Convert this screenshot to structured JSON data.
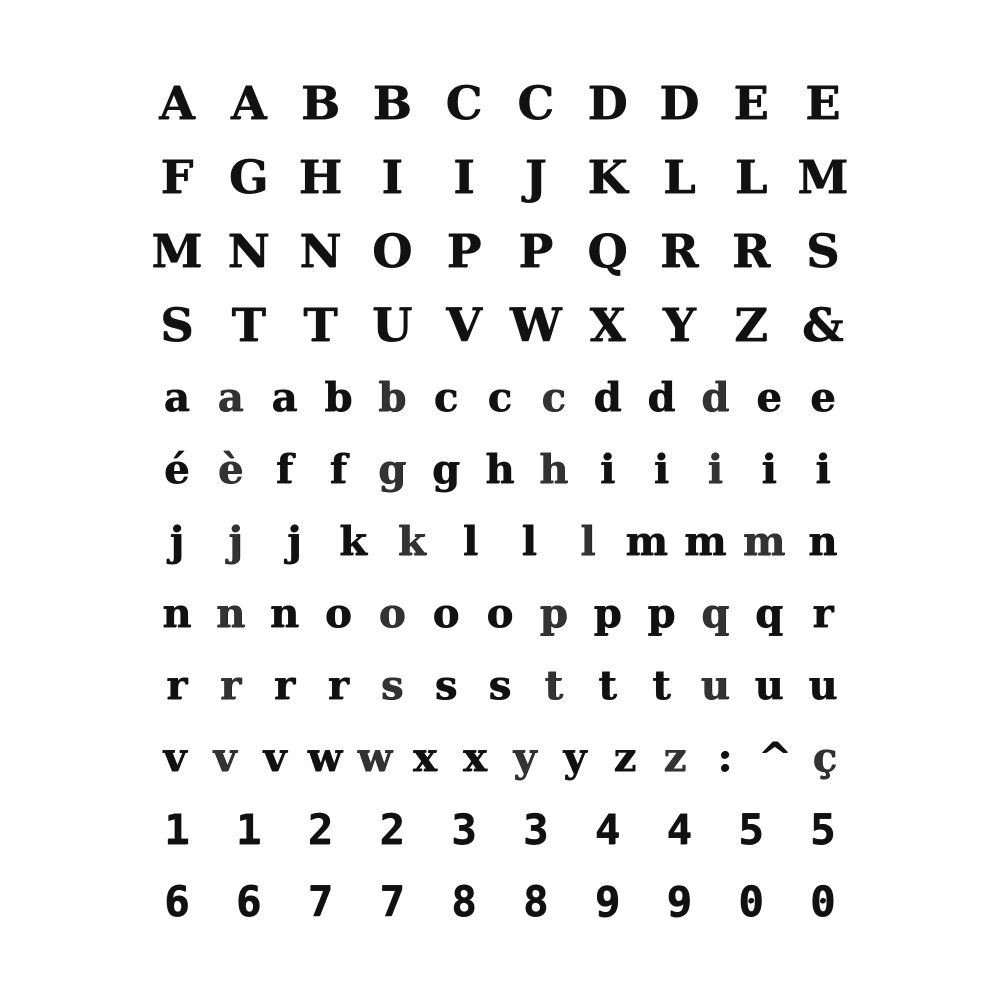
{
  "sheet": {
    "rows": [
      {
        "kind": "upper",
        "glyphs": [
          "A",
          "A",
          "B",
          "B",
          "C",
          "C",
          "D",
          "D",
          "E",
          "E"
        ]
      },
      {
        "kind": "upper",
        "glyphs": [
          "F",
          "G",
          "H",
          "I",
          "I",
          "J",
          "K",
          "L",
          "L",
          "M"
        ]
      },
      {
        "kind": "upper",
        "glyphs": [
          "M",
          "N",
          "N",
          "O",
          "P",
          "P",
          "Q",
          "R",
          "R",
          "S"
        ]
      },
      {
        "kind": "upper",
        "glyphs": [
          "S",
          "T",
          "T",
          "U",
          "V",
          "W",
          "X",
          "Y",
          "Z",
          "&"
        ]
      },
      {
        "kind": "lower",
        "glyphs": [
          "a",
          "a",
          "a",
          "b",
          "b",
          "c",
          "c",
          "c",
          "d",
          "d",
          "d",
          "e",
          "e"
        ]
      },
      {
        "kind": "lower",
        "glyphs": [
          "é",
          "è",
          "f",
          "f",
          "g",
          "g",
          "h",
          "h",
          "i",
          "i",
          "i",
          "i",
          "i"
        ]
      },
      {
        "kind": "lower",
        "glyphs": [
          "j",
          "j",
          "j",
          "k",
          "k",
          "l",
          "l",
          "l",
          "m",
          "m",
          "m",
          "n"
        ]
      },
      {
        "kind": "lower",
        "glyphs": [
          "n",
          "n",
          "n",
          "o",
          "o",
          "o",
          "o",
          "p",
          "p",
          "p",
          "q",
          "q",
          "r"
        ]
      },
      {
        "kind": "lower",
        "glyphs": [
          "r",
          "r",
          "r",
          "r",
          "s",
          "s",
          "s",
          "t",
          "t",
          "t",
          "u",
          "u",
          "u"
        ]
      },
      {
        "kind": "lower",
        "glyphs": [
          "v",
          "v",
          "v",
          "w",
          "w",
          "x",
          "x",
          "y",
          "y",
          "z",
          "z",
          ":",
          "^",
          "ç"
        ]
      },
      {
        "kind": "digit",
        "glyphs": [
          "1",
          "1",
          "2",
          "2",
          "3",
          "3",
          "4",
          "4",
          "5",
          "5"
        ]
      },
      {
        "kind": "digit",
        "glyphs": [
          "6",
          "6",
          "7",
          "7",
          "8",
          "8",
          "9",
          "9",
          "0",
          "0"
        ]
      }
    ]
  }
}
